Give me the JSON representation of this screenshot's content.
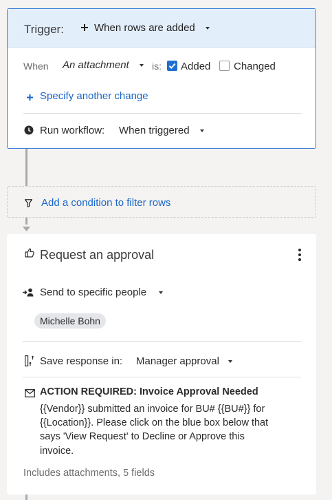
{
  "trigger": {
    "label": "Trigger:",
    "event": "When rows are added",
    "when_label": "When",
    "when_field": "An attachment",
    "is_label": "is:",
    "options": [
      {
        "label": "Added",
        "checked": true
      },
      {
        "label": "Changed",
        "checked": false
      }
    ],
    "specify_another": "Specify another change",
    "run_label": "Run workflow:",
    "run_value": "When triggered"
  },
  "filter": {
    "label": "Add a condition to filter rows"
  },
  "approval": {
    "title": "Request an approval",
    "send_to": "Send to specific people",
    "recipient": "Michelle Bohn",
    "save_label": "Save response in:",
    "save_value": "Manager approval",
    "message_subject": "ACTION REQUIRED: Invoice Approval Needed",
    "message_lines": [
      "{{Vendor}} submitted an invoice for BU# {{BU#}} for",
      "{{Location}}. Please click on the blue box below that",
      "says 'View Request' to Decline or Approve this",
      "invoice."
    ],
    "footer": "Includes attachments, 5 fields"
  },
  "colors": {
    "accent": "#1a66c9",
    "trigger_header_bg": "#e3eefb",
    "trigger_border": "#3b7dd8",
    "canvas_bg": "#f4f3f1"
  },
  "icons": {
    "add_event": "plus-icon",
    "specify": "plus-icon",
    "run": "clock-icon",
    "filter": "filter-icon",
    "approval": "thumbs-up-icon",
    "send": "person-add-icon",
    "save": "column-icon",
    "message": "envelope-icon",
    "menu": "more-vertical-icon"
  }
}
